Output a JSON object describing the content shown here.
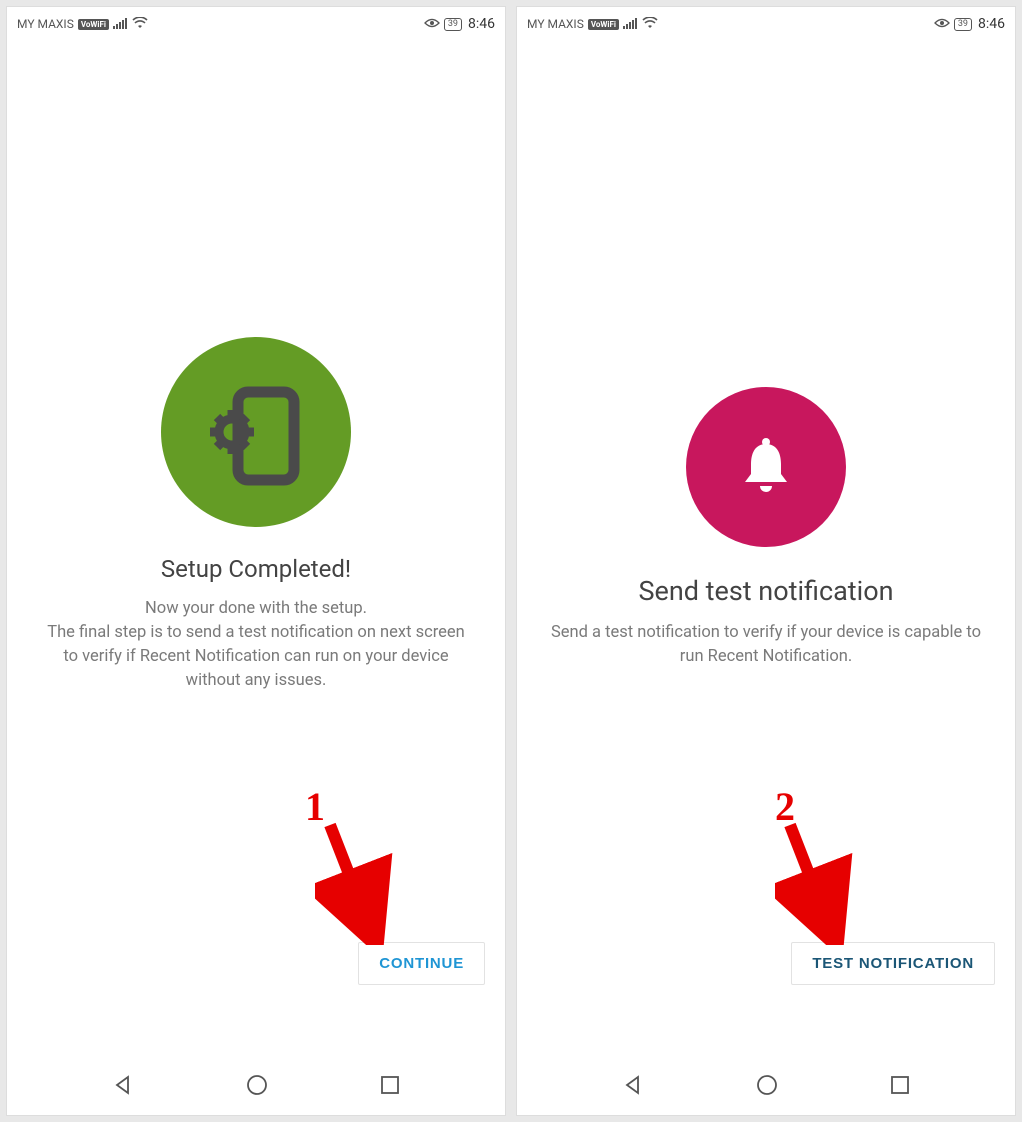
{
  "status": {
    "carrier": "MY MAXIS",
    "vowifi": "VoWiFi",
    "battery": "39",
    "time": "8:46"
  },
  "left": {
    "title": "Setup Completed!",
    "desc": "Now your done with the setup.\nThe final step is to send a test notification on next screen to verify if Recent Notification can run on your device without any issues.",
    "button": "CONTINUE",
    "annotation": "1"
  },
  "right": {
    "title": "Send test notification",
    "desc": "Send a test notification to verify if your device is capable to run Recent Notification.",
    "button": "TEST NOTIFICATION",
    "annotation": "2"
  }
}
